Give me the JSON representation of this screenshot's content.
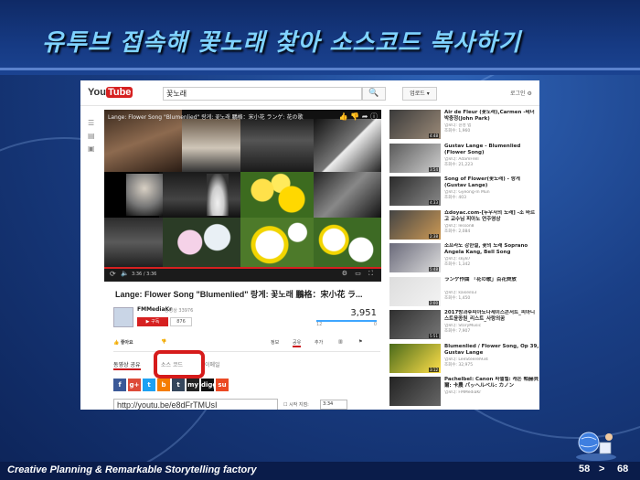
{
  "slide": {
    "title": "유투브 접속해 꽃노래 찾아 소스코드 복사하기",
    "footer": "Creative Planning & Remarkable  Storytelling  factory",
    "page_current": "58",
    "page_sep": ">",
    "page_next": "68"
  },
  "youtube": {
    "logo_you": "You",
    "logo_tube": "Tube",
    "search_value": "꽃노래",
    "search_icon": "🔍",
    "upload_label": "업로드 ▾",
    "signin": "로그인 ⚙",
    "video": {
      "overlay_title": "Lange: Flower Song \"Blumenlied\" 랑게: 꽃노래 鵬格：宋小花 ランゲ: 花の歌",
      "time": "3:36 / 3:36",
      "title": "Lange: Flower Song \"Blumenlied\" 랑게: 꽃노래 鵬格：宋小花 ラ...",
      "channel": "FMMediaKr",
      "channel_videos": "동영상 33976",
      "subscribe": "▶ 구독",
      "subscribers": "876",
      "views": "3,951",
      "likes": "12",
      "dislikes": "0",
      "action_like": "좋아요",
      "action_info": "정보",
      "action_share": "공유",
      "action_add": "추가",
      "tab_share": "동영상 공유",
      "tab_embed": "소스 코드",
      "tab_email": "이메일",
      "url": "http://youtu.be/e8dFrTMUsI",
      "start_label": "시작 지점:",
      "start_value": "3:34"
    },
    "social": [
      {
        "label": "f",
        "color": "#3b5998"
      },
      {
        "label": "g+",
        "color": "#dd4b39"
      },
      {
        "label": "t",
        "color": "#1da1f2"
      },
      {
        "label": "b",
        "color": "#f57d00"
      },
      {
        "label": "t",
        "color": "#35465c"
      },
      {
        "label": "my",
        "color": "#222222"
      },
      {
        "label": "digg",
        "color": "#111111"
      },
      {
        "label": "su",
        "color": "#eb4924"
      }
    ],
    "related": [
      {
        "title": "Air de Fleur (꽃노래),Carmen -테너 박충정(John Park)",
        "meta": "업로더: 윤성 범",
        "views": "조회수: 1,960",
        "dur": "4:48"
      },
      {
        "title": "Gustav Lange - Blumenlied (Flower Song)",
        "meta": "업로더: AdamFrell",
        "views": "조회수: 21,223",
        "dur": "3:54"
      },
      {
        "title": "Song of Flower(꽃노래) - 랑게 (Gustav Lange)",
        "meta": "업로더: Gyeong-In Mun",
        "views": "조회수: 403",
        "dur": "4:33"
      },
      {
        "title": "쇼doyac.com-[두우사의 노래] -조 바르고 교수님 피아노 연주영상",
        "meta": "업로더: lesson8",
        "views": "조회수: 2,084",
        "dur": "2:38"
      },
      {
        "title": "소프라노 강한설, 꽃의 노래 Soprano Angela Kang, Bell Song",
        "meta": "업로더: sky87",
        "views": "조회수: 1,342",
        "dur": "5:48"
      },
      {
        "title": "ランゲ作曲 「花の歌」百花齊放",
        "meta": "업로더: kaiseiIo3",
        "views": "조회수: 1,450",
        "dur": "2:00"
      },
      {
        "title": "2017방과후피아노다세이스콘서트_피아니스트윤종원_리스트_사랑의꿈",
        "meta": "업로더: StoryMusic",
        "views": "조회수: 7,907",
        "dur": "5:51"
      },
      {
        "title": "Blumenlied / Flower Song, Op 39, Gustav Lange",
        "meta": "업로더: LeeSteerel934",
        "views": "조회수: 32,975",
        "dur": "3:12"
      },
      {
        "title": "Pachelbel: Canon 파헬벨: 캐논 帕赫貝爾: 卡農 パッヘルベル: カノン",
        "meta": "업로더: FMMediaKr",
        "views": "",
        "dur": ""
      }
    ]
  }
}
